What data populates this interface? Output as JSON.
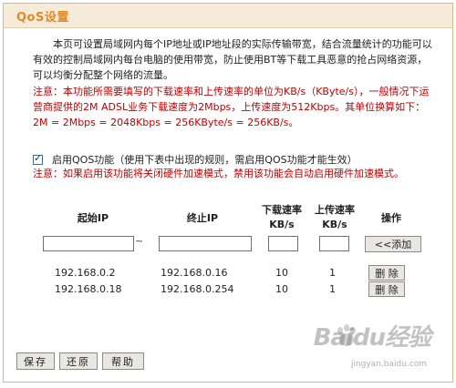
{
  "window": {
    "title": "QoS设置"
  },
  "intro": "本页可设置局域网内每个IP地址或IP地址段的实际传输带宽，结合流量统计的功能可以有效的控制局域网内每台电脑的使用带宽，防止使用BT等下载工具恶意的抢占网络资源，可以均衡分配整个网络的流量。",
  "note_units": "注意：本功能所需要填写的下载速率和上传速率的单位为KB/s（KByte/s），一般情况下运营商提供的2M ADSL业务下载速度为2Mbps，上传速度为512Kbps。其单位换算如下： 2M = 2Mbps = 2048Kbps = 256KByte/s = 256KB/s。",
  "enable": {
    "checked": true,
    "label": "启用QOS功能（使用下表中出现的规则，需启用QOS功能才能生效）"
  },
  "note_hw": "注意：如果启用该功能将关闭硬件加速模式，禁用该功能会自动启用硬件加速模式。",
  "table": {
    "headers": {
      "start_ip": "起始IP",
      "end_ip": "终止IP",
      "down_rate": "下载速率",
      "up_rate": "上传速率",
      "unit": "KB/s",
      "op": "操作"
    },
    "new_row": {
      "start_ip": "",
      "end_ip": "",
      "down": "",
      "up": "",
      "separator": "~",
      "add_label": "<<添加"
    },
    "rows": [
      {
        "start_ip": "192.168.0.2",
        "end_ip": "192.168.0.16",
        "down": "10",
        "up": "1",
        "delete_label": "删 除"
      },
      {
        "start_ip": "192.168.0.18",
        "end_ip": "192.168.0.254",
        "down": "10",
        "up": "1",
        "delete_label": "删 除"
      }
    ]
  },
  "buttons": {
    "save": "保存",
    "restore": "还原",
    "help": "帮助"
  },
  "watermark": {
    "brand": "Baidu经验",
    "site": "jingyan.baidu.com"
  }
}
